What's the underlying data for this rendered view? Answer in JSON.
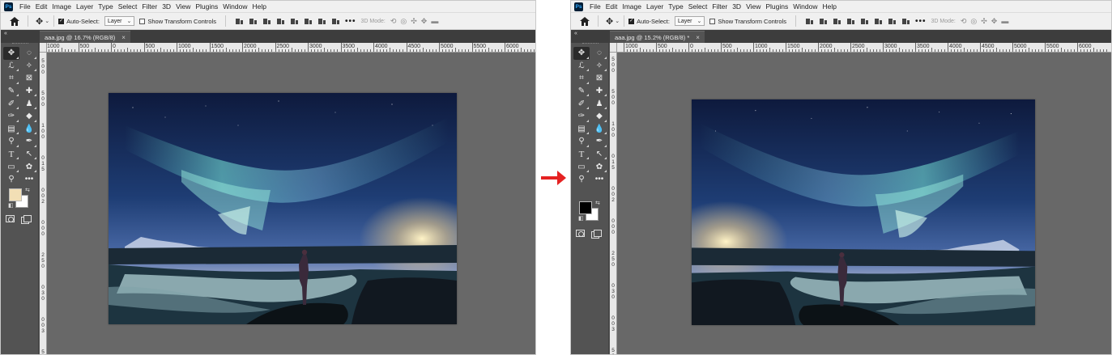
{
  "menu": {
    "items": [
      "File",
      "Edit",
      "Image",
      "Layer",
      "Type",
      "Select",
      "Filter",
      "3D",
      "View",
      "Plugins",
      "Window",
      "Help"
    ]
  },
  "options": {
    "auto_select_label": "Auto-Select:",
    "layer_select_value": "Layer",
    "show_transform_label": "Show Transform Controls",
    "mode3d_label": "3D Mode:"
  },
  "ruler": {
    "labels": [
      "1000",
      "500",
      "0",
      "500",
      "1000",
      "1500",
      "2000",
      "2500",
      "3000",
      "3500",
      "4000",
      "4500",
      "5000",
      "5500",
      "6000"
    ],
    "vertical_labels": [
      "5",
      "0",
      "0",
      "5",
      "0",
      "0",
      "1",
      "0",
      "0",
      "0",
      "1",
      "5",
      "0",
      "0",
      "2",
      "0",
      "0",
      "0",
      "2",
      "5",
      "0",
      "0",
      "3",
      "0",
      "0",
      "0",
      "3",
      "5",
      "0",
      "0"
    ]
  },
  "before": {
    "tab_title": "aaa.jpg @ 16.7% (RGB/8)",
    "tab_close": "×",
    "fg_color": "#f2dfb5",
    "bg_color": "#ffffff"
  },
  "after": {
    "tab_title": "aaa.jpg @ 15.2% (RGB/8) *",
    "tab_close": "×",
    "fg_color": "#000000",
    "bg_color": "#ffffff"
  },
  "transition": {
    "arrow_color": "#e52222"
  },
  "tools": [
    "move-tool",
    "marquee-tool",
    "lasso-tool",
    "magic-wand-tool",
    "crop-tool",
    "frame-tool",
    "eyedropper-tool",
    "healing-brush-tool",
    "brush-tool",
    "clone-stamp-tool",
    "history-brush-tool",
    "eraser-tool",
    "gradient-tool",
    "blur-tool",
    "dodge-tool",
    "pen-tool",
    "type-tool",
    "path-selection-tool",
    "rectangle-tool",
    "custom-shape-tool",
    "zoom-tool",
    "more-tools"
  ]
}
